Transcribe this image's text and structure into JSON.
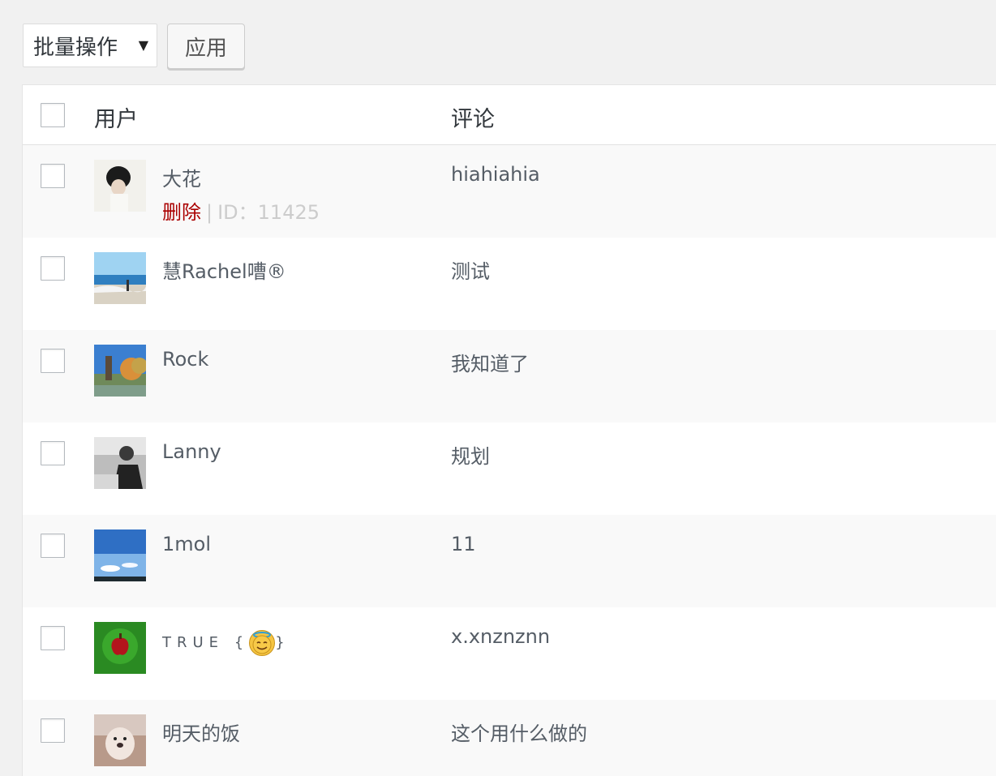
{
  "toolbar": {
    "bulk_action_label": "批量操作",
    "apply_label": "应用"
  },
  "table": {
    "headers": {
      "user": "用户",
      "comment": "评论"
    },
    "rows": [
      {
        "name": "大花",
        "comment": "hiahiahia",
        "delete_label": "删除",
        "separator": "|",
        "id_label": "ID：11425"
      },
      {
        "name": "慧Rachel嘈®",
        "comment": "测试"
      },
      {
        "name": "Rock",
        "comment": "我知道了"
      },
      {
        "name": "Lanny",
        "comment": "规划"
      },
      {
        "name": "1mol",
        "comment": "11"
      },
      {
        "name_prefix": "TRUE",
        "name_open": "{",
        "name_close": "}",
        "comment": "x.xnznznn"
      },
      {
        "name": "明天的饭",
        "comment": "这个用什么做的"
      }
    ]
  }
}
